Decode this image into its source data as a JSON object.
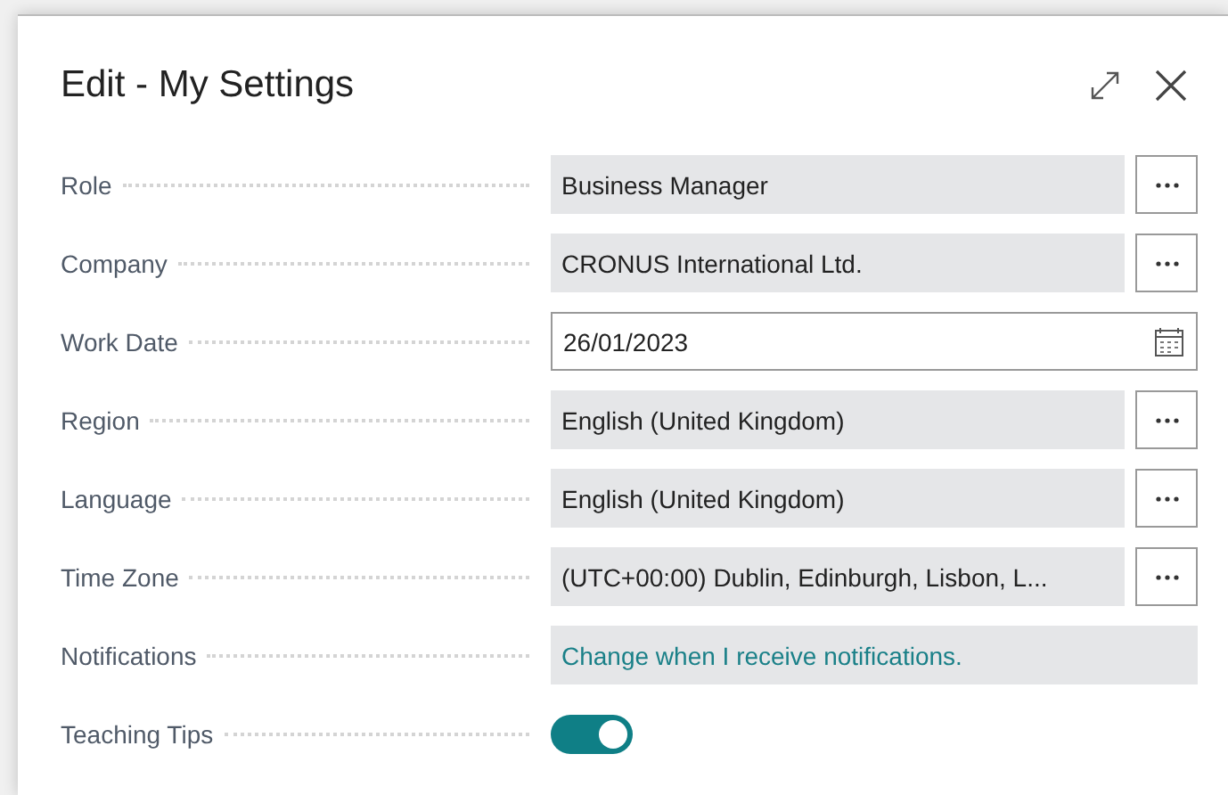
{
  "dialog": {
    "title": "Edit - My Settings"
  },
  "fields": [
    {
      "label": "Role",
      "kind": "lookup",
      "value": "Business Manager"
    },
    {
      "label": "Company",
      "kind": "lookup",
      "value": "CRONUS International Ltd."
    },
    {
      "label": "Work Date",
      "kind": "date",
      "value": "26/01/2023"
    },
    {
      "label": "Region",
      "kind": "lookup",
      "value": "English (United Kingdom)"
    },
    {
      "label": "Language",
      "kind": "lookup",
      "value": "English (United Kingdom)"
    },
    {
      "label": "Time Zone",
      "kind": "lookup",
      "value": "(UTC+00:00) Dublin, Edinburgh, Lisbon, L..."
    },
    {
      "label": "Notifications",
      "kind": "link",
      "value": "Change when I receive notifications."
    },
    {
      "label": "Teaching Tips",
      "kind": "toggle",
      "on": true
    }
  ]
}
